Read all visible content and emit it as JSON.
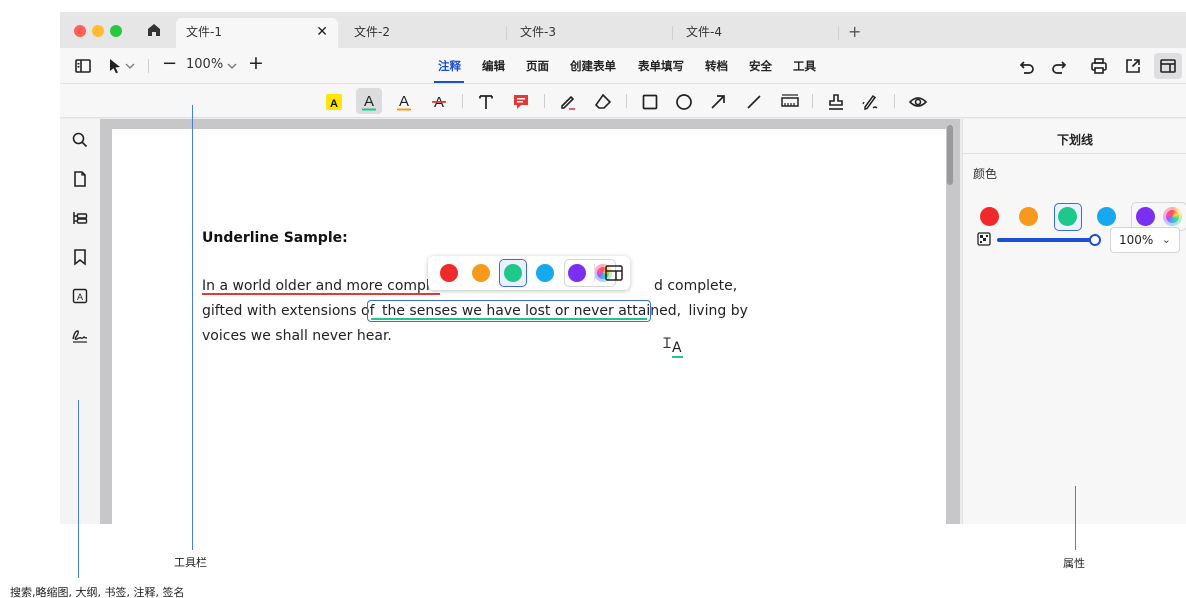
{
  "window": {
    "tabs": [
      {
        "label": "文件-1",
        "active": true
      },
      {
        "label": "文件-2",
        "active": false
      },
      {
        "label": "文件-3",
        "active": false
      },
      {
        "label": "文件-4",
        "active": false
      }
    ],
    "close_glyph": "✕",
    "add_tab_glyph": "+",
    "traffic_colors": [
      "#ff5f57",
      "#febc2e",
      "#28c840"
    ]
  },
  "toolbar": {
    "zoom_value": "100%",
    "zoom_minus": "−",
    "zoom_plus": "+",
    "menu": [
      "注释",
      "编辑",
      "页面",
      "创建表单",
      "表单填写",
      "转档",
      "安全",
      "工具"
    ],
    "active_menu": "注释",
    "icons_left": [
      "sidebar-toggle-icon",
      "pointer-icon",
      "chevron-down-icon"
    ],
    "icons_right": [
      "undo-icon",
      "redo-icon",
      "print-icon",
      "share-icon",
      "panel-layout-icon"
    ]
  },
  "annotation_tools": [
    "highlight-icon",
    "underline-text-icon",
    "squiggly-text-icon",
    "strikethrough-icon",
    "text-box-icon",
    "comment-icon",
    "pencil-icon",
    "eraser-icon",
    "rectangle-icon",
    "ellipse-icon",
    "arrow-icon",
    "line-icon",
    "measure-icon",
    "stamp-icon",
    "signature-icon",
    "eye-icon"
  ],
  "left_sidebar": [
    "search-icon",
    "thumbnail-icon",
    "outline-icon",
    "bookmark-icon",
    "annotation-icon",
    "signature-icon"
  ],
  "document": {
    "title": "Underline Sample:",
    "line1_start": "In a world older and more complet",
    "line1_end": "d complete,",
    "line2_prefix": "gifted with extensions of ",
    "line2_selected": "the senses we have lost or never attained,",
    "line2_suffix": " living by",
    "line3": "voices we shall never hear.",
    "cursor_ibeam": "Ｉ",
    "cursor_letter": "A"
  },
  "color_palette": {
    "colors": [
      "#f02a2a",
      "#f79a1c",
      "#1ec78a",
      "#16a9ef",
      "#7b2ff0"
    ],
    "selected_index": 2
  },
  "properties_panel": {
    "title": "下划线",
    "color_label": "颜色",
    "opacity_value": "100%",
    "opacity_fraction": 1.0
  },
  "callouts": {
    "toolbar": "工具栏",
    "properties": "属性",
    "sidebar": "搜索,略缩图, 大纲, 书签, 注释, 签名"
  }
}
